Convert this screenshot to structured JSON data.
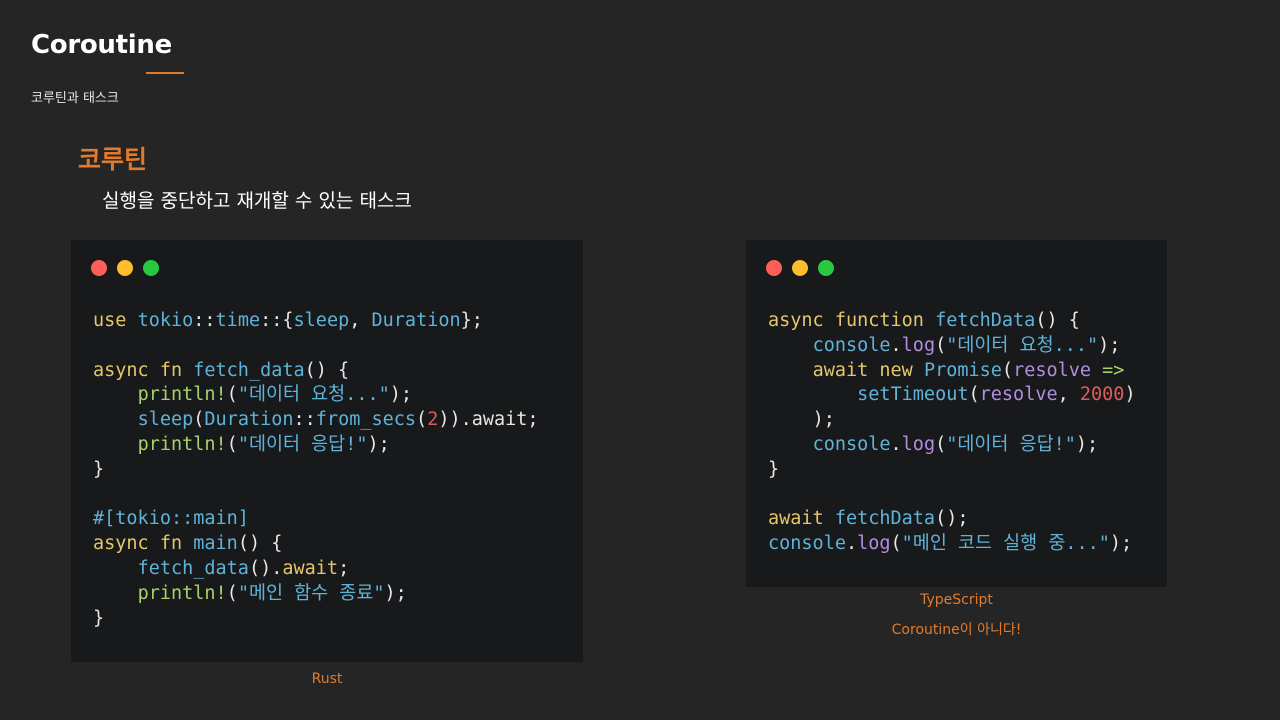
{
  "slide": {
    "title": "Coroutine",
    "subtitle": "코루틴과 태스크",
    "accent_color": "#e07b2e",
    "background": "#252525"
  },
  "section": {
    "heading": "코루틴",
    "description": "실행을 중단하고 재개할 수 있는 태스크"
  },
  "rust_panel": {
    "caption": "Rust",
    "lines": [
      [
        [
          "keyword",
          "use "
        ],
        [
          "fn",
          "tokio"
        ],
        [
          "punct",
          "::"
        ],
        [
          "fn",
          "time"
        ],
        [
          "punct",
          "::{"
        ],
        [
          "fn",
          "sleep"
        ],
        [
          "punct",
          ", "
        ],
        [
          "type",
          "Duration"
        ],
        [
          "punct",
          "};"
        ]
      ],
      [],
      [
        [
          "keyword",
          "async fn "
        ],
        [
          "fn",
          "fetch_data"
        ],
        [
          "punct",
          "() {"
        ]
      ],
      [
        [
          "plain",
          "    "
        ],
        [
          "macro",
          "println!"
        ],
        [
          "punct",
          "("
        ],
        [
          "string",
          "\"데이터 요청...\""
        ],
        [
          "punct",
          ");"
        ]
      ],
      [
        [
          "plain",
          "    "
        ],
        [
          "fn",
          "sleep"
        ],
        [
          "punct",
          "("
        ],
        [
          "type",
          "Duration"
        ],
        [
          "punct",
          "::"
        ],
        [
          "fn",
          "from_secs"
        ],
        [
          "punct",
          "("
        ],
        [
          "number",
          "2"
        ],
        [
          "punct",
          ")).await;"
        ]
      ],
      [
        [
          "plain",
          "    "
        ],
        [
          "macro",
          "println!"
        ],
        [
          "punct",
          "("
        ],
        [
          "string",
          "\"데이터 응답!\""
        ],
        [
          "punct",
          ");"
        ]
      ],
      [
        [
          "punct",
          "}"
        ]
      ],
      [],
      [
        [
          "attr",
          "#[tokio::main]"
        ]
      ],
      [
        [
          "keyword",
          "async fn "
        ],
        [
          "fn",
          "main"
        ],
        [
          "punct",
          "() {"
        ]
      ],
      [
        [
          "plain",
          "    "
        ],
        [
          "fn",
          "fetch_data"
        ],
        [
          "punct",
          "()."
        ],
        [
          "keyword",
          "await"
        ],
        [
          "punct",
          ";"
        ]
      ],
      [
        [
          "plain",
          "    "
        ],
        [
          "macro",
          "println!"
        ],
        [
          "punct",
          "("
        ],
        [
          "string",
          "\"메인 함수 종료\""
        ],
        [
          "punct",
          ");"
        ]
      ],
      [
        [
          "punct",
          "}"
        ]
      ]
    ]
  },
  "ts_panel": {
    "caption": "TypeScript",
    "note": "Coroutine이 아니다!",
    "lines": [
      [
        [
          "keyword",
          "async function "
        ],
        [
          "fn",
          "fetchData"
        ],
        [
          "punct",
          "() {"
        ]
      ],
      [
        [
          "plain",
          "    "
        ],
        [
          "fn",
          "console"
        ],
        [
          "punct",
          "."
        ],
        [
          "property",
          "log"
        ],
        [
          "punct",
          "("
        ],
        [
          "string",
          "\"데이터 요청...\""
        ],
        [
          "punct",
          ");"
        ]
      ],
      [
        [
          "plain",
          "    "
        ],
        [
          "keyword",
          "await new "
        ],
        [
          "type",
          "Promise"
        ],
        [
          "punct",
          "("
        ],
        [
          "param",
          "resolve"
        ],
        [
          "arrow",
          " =>"
        ]
      ],
      [
        [
          "plain",
          "        "
        ],
        [
          "fn",
          "setTimeout"
        ],
        [
          "punct",
          "("
        ],
        [
          "param",
          "resolve"
        ],
        [
          "punct",
          ", "
        ],
        [
          "number",
          "2000"
        ],
        [
          "punct",
          ")"
        ]
      ],
      [
        [
          "plain",
          "    "
        ],
        [
          "punct",
          ");"
        ]
      ],
      [
        [
          "plain",
          "    "
        ],
        [
          "fn",
          "console"
        ],
        [
          "punct",
          "."
        ],
        [
          "property",
          "log"
        ],
        [
          "punct",
          "("
        ],
        [
          "string",
          "\"데이터 응답!\""
        ],
        [
          "punct",
          ");"
        ]
      ],
      [
        [
          "punct",
          "}"
        ]
      ],
      [],
      [
        [
          "keyword",
          "await "
        ],
        [
          "fn",
          "fetchData"
        ],
        [
          "punct",
          "();"
        ]
      ],
      [
        [
          "fn",
          "console"
        ],
        [
          "punct",
          "."
        ],
        [
          "property",
          "log"
        ],
        [
          "punct",
          "("
        ],
        [
          "string",
          "\"메인 코드 실행 중...\""
        ],
        [
          "punct",
          ");"
        ]
      ]
    ]
  },
  "window_dots": {
    "red": "#ff5f57",
    "yellow": "#febc2e",
    "green": "#28c840"
  }
}
